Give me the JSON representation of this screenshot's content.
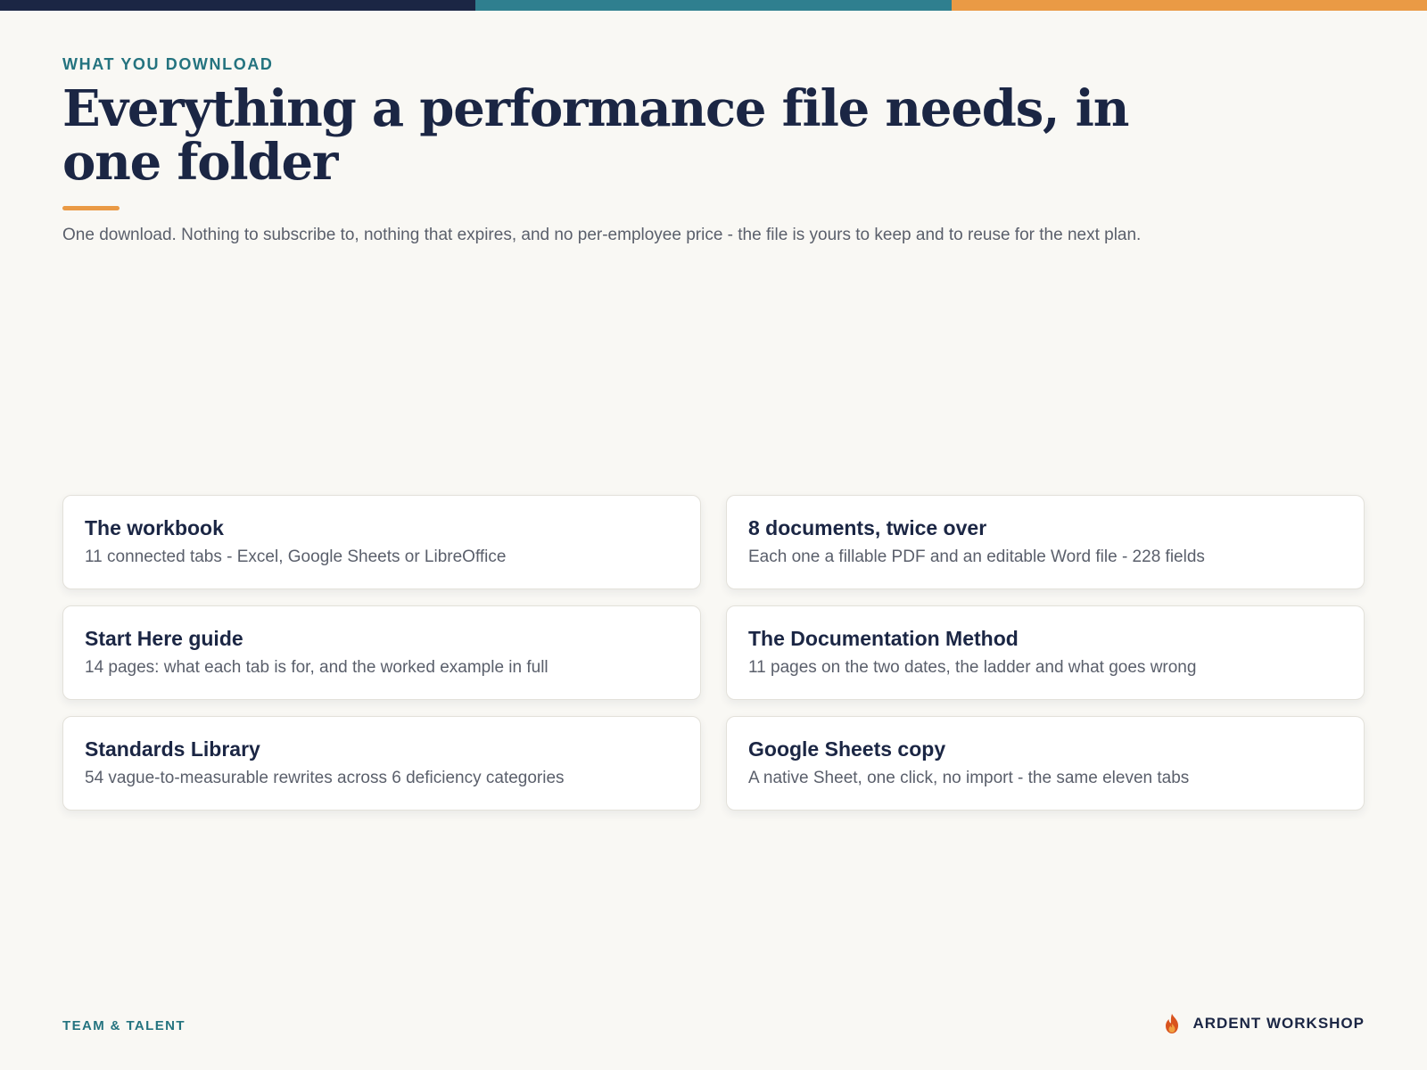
{
  "colors": {
    "navy": "#1b2644",
    "teal": "#2f7f8f",
    "orange": "#ea9a45",
    "background": "#f9f8f4"
  },
  "header": {
    "eyebrow": "WHAT YOU DOWNLOAD",
    "title": "Everything a performance file needs, in one folder",
    "lede": "One download. Nothing to subscribe to, nothing that expires, and no per-employee price - the file is yours to keep and to reuse for the next plan."
  },
  "cards": [
    {
      "title": "The workbook",
      "desc": "11 connected tabs - Excel, Google Sheets or LibreOffice"
    },
    {
      "title": "8 documents, twice over",
      "desc": "Each one a fillable PDF and an editable Word file - 228 fields"
    },
    {
      "title": "Start Here guide",
      "desc": "14 pages: what each tab is for, and the worked example in full"
    },
    {
      "title": "The Documentation Method",
      "desc": "11 pages on the two dates, the ladder and what goes wrong"
    },
    {
      "title": "Standards Library",
      "desc": "54 vague-to-measurable rewrites across 6 deficiency categories"
    },
    {
      "title": "Google Sheets copy",
      "desc": "A native Sheet, one click, no import - the same eleven tabs"
    }
  ],
  "footer": {
    "left": "TEAM & TALENT",
    "brand_icon": "flame-icon",
    "brand": "ARDENT WORKSHOP"
  }
}
